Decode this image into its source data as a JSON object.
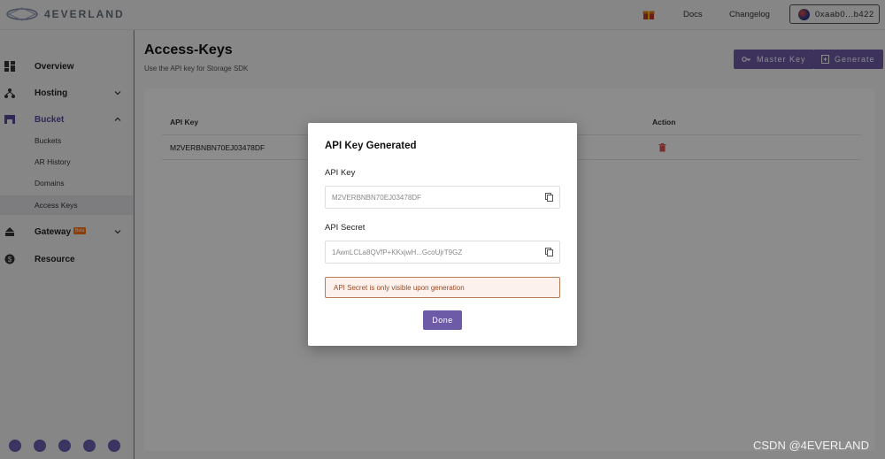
{
  "brand": {
    "name": "4EVERLAND"
  },
  "topbar": {
    "gift_icon": "gift-icon",
    "docs": "Docs",
    "changelog": "Changelog",
    "wallet": "0xaab0...b422"
  },
  "sidebar": {
    "overview": "Overview",
    "hosting": "Hosting",
    "bucket": "Bucket",
    "bucket_items": [
      "Buckets",
      "AR History",
      "Domains",
      "Access Keys"
    ],
    "gateway": "Gateway",
    "gateway_badge": "Beta",
    "resource": "Resource",
    "socials": [
      "twitter-icon",
      "discord-icon",
      "telegram-icon",
      "medium-icon",
      "github-icon"
    ]
  },
  "page": {
    "title": "Access-Keys",
    "subtitle": "Use the API key for Storage SDK",
    "master_key_label": "Master Key",
    "generate_label": "Generate",
    "table": {
      "headers": [
        "API Key",
        "Action"
      ],
      "rows": [
        {
          "api_key": "M2VERBNBN70EJ03478DF"
        }
      ]
    }
  },
  "modal": {
    "title": "API Key Generated",
    "api_key_label": "API Key",
    "api_key_value": "M2VERBNBN70EJ03478DF",
    "api_secret_label": "API Secret",
    "api_secret_value": "1AwnLCLa8QVfP+KKxjwH...GcoUjrT9GZ",
    "notice": "API Secret is only visible upon generation",
    "done_label": "Done"
  },
  "watermark": "CSDN @4EVERLAND",
  "colors": {
    "accent": "#6d5ba8",
    "notice_border": "#b97a55",
    "notice_bg": "#fcf1ec",
    "danger": "#d9534f"
  }
}
